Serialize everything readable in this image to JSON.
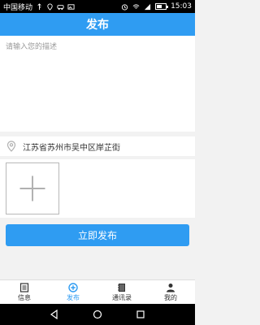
{
  "status_bar": {
    "carrier": "中国移动",
    "time": "15:03",
    "battery_level": 0.6
  },
  "header": {
    "title": "发布"
  },
  "description": {
    "placeholder": "请输入您的描述",
    "value": ""
  },
  "location": {
    "text": "江苏省苏州市吴中区岸芷街",
    "icon": "map-pin-icon"
  },
  "photos": {
    "add_icon": "plus-icon"
  },
  "publish_button": {
    "label": "立即发布"
  },
  "tabs": [
    {
      "label": "信息",
      "icon": "list-icon",
      "active": false
    },
    {
      "label": "发布",
      "icon": "plus-circle-icon",
      "active": true
    },
    {
      "label": "通讯录",
      "icon": "contacts-icon",
      "active": false
    },
    {
      "label": "我的",
      "icon": "person-icon",
      "active": false
    }
  ],
  "colors": {
    "primary": "#2f9cf2",
    "background": "#f2f2f2"
  }
}
